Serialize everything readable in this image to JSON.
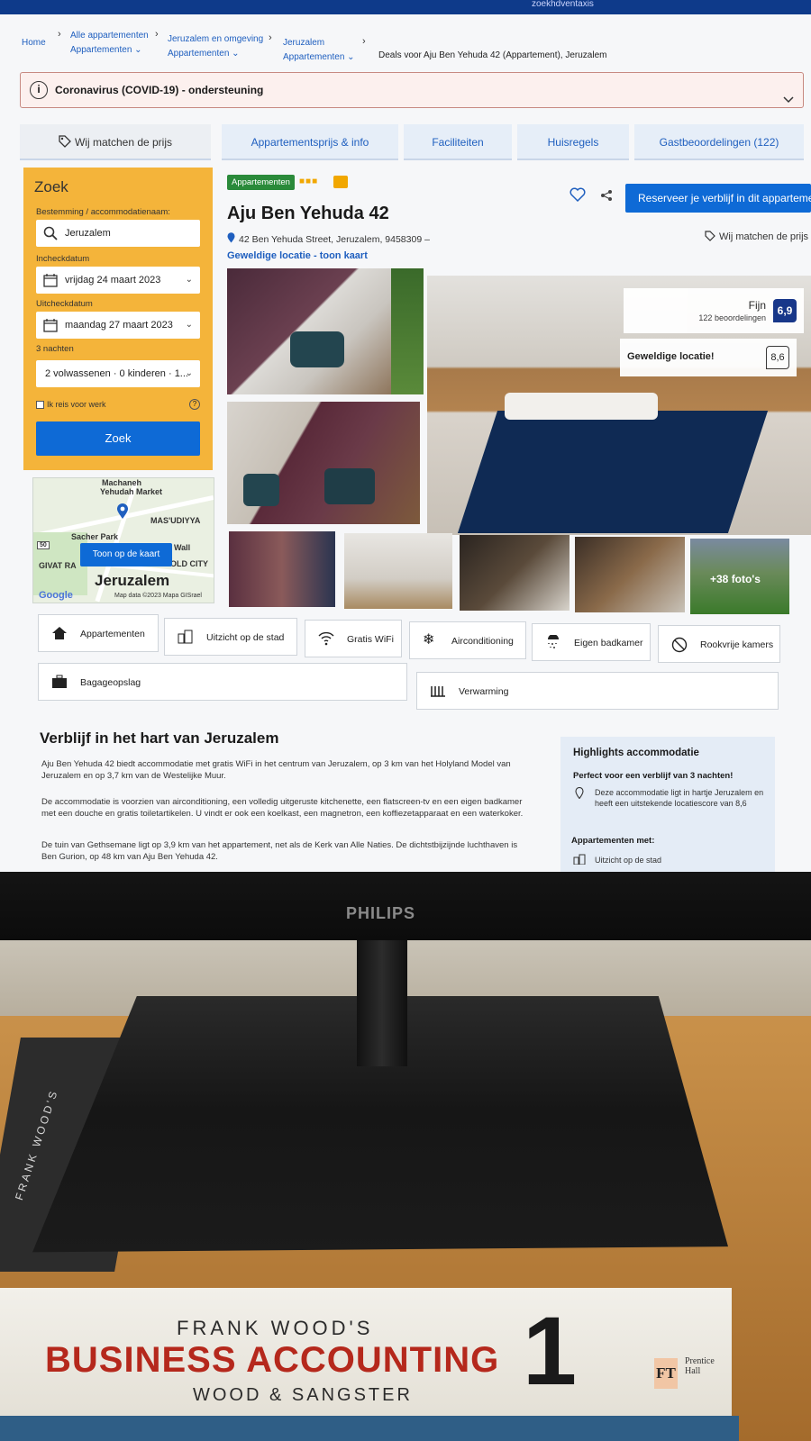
{
  "topbar": {
    "text": "zoekhdventaxis"
  },
  "breadcrumb": {
    "home": "Home",
    "c1": "Alle appartementen",
    "c1_sub": "Appartementen",
    "c2": "Jeruzalem en omgeving",
    "c2_sub": "Appartementen",
    "c3": "Jeruzalem",
    "c3_sub": "Appartementen",
    "c4": "Deals voor Aju Ben Yehuda 42 (Appartement), Jeruzalem"
  },
  "covid": {
    "text": "Coronavirus (COVID-19) - ondersteuning"
  },
  "tabs": [
    {
      "label": "Wij matchen de prijs"
    },
    {
      "label": "Appartementsprijs & info"
    },
    {
      "label": "Faciliteiten"
    },
    {
      "label": "Huisregels"
    },
    {
      "label": "Gastbeoordelingen (122)"
    }
  ],
  "search": {
    "title": "Zoek",
    "dest_label": "Bestemming / accommodatienaam:",
    "dest_value": "Jeruzalem",
    "checkin_label": "Incheckdatum",
    "checkin_value": "vrijdag 24 maart 2023",
    "checkout_label": "Uitcheckdatum",
    "checkout_value": "maandag 27 maart 2023",
    "nights": "3 nachten",
    "guests_value": "2 volwassenen · 0 kinderen · 1...",
    "work_label": "Ik reis voor werk",
    "button": "Zoek"
  },
  "map": {
    "city": "Jeruzalem",
    "button": "Toon op de kaart",
    "labels": [
      "Machaneh",
      "Yehudah Market",
      "MAS'UDIYYA",
      "Sacher Park",
      "GIVAT RA",
      "Wall",
      "OLD CITY",
      "50"
    ],
    "google": "Google",
    "copyright": "Map data ©2023 Mapa GISrael"
  },
  "property": {
    "type_badge": "Appartementen",
    "name": "Aju Ben Yehuda 42",
    "address": "42 Ben Yehuda Street, Jeruzalem, 9458309 –",
    "location_link": "Geweldige locatie - toon kaart",
    "reserve_button": "Reserveer je verblijf in dit appartement",
    "price_match": "Wij matchen de prijs",
    "rating_word": "Fijn",
    "rating_count": "122 beoordelingen",
    "rating_score": "6,9",
    "location_word": "Geweldige locatie!",
    "location_score": "8,6",
    "more_photos": "+38 foto's"
  },
  "facilities": [
    {
      "label": "Appartementen",
      "icon": "home-icon"
    },
    {
      "label": "Uitzicht op de stad",
      "icon": "city-icon"
    },
    {
      "label": "Gratis WiFi",
      "icon": "wifi-icon"
    },
    {
      "label": "Airconditioning",
      "icon": "snowflake-icon"
    },
    {
      "label": "Eigen badkamer",
      "icon": "shower-icon"
    },
    {
      "label": "Rookvrije kamers",
      "icon": "no-smoking-icon"
    },
    {
      "label": "Bagageopslag",
      "icon": "luggage-icon"
    },
    {
      "label": "Verwarming",
      "icon": "heater-icon"
    }
  ],
  "description": {
    "title": "Verblijf in het hart van Jeruzalem",
    "p1": "Aju Ben Yehuda 42 biedt accommodatie met gratis WiFi in het centrum van Jeruzalem, op 3 km van het Holyland Model van Jeruzalem en op 3,7 km van de Westelijke Muur.",
    "p2": "De accommodatie is voorzien van airconditioning, een volledig uitgeruste kitchenette, een flatscreen-tv en een eigen badkamer met een douche en gratis toiletartikelen. U vindt er ook een koelkast, een magnetron, een koffiezetapparaat en een waterkoker.",
    "p3": "De tuin van Gethsemane ligt op 3,9 km van het appartement, net als de Kerk van Alle Naties. De dichtstbijzijnde luchthaven is Ben Gurion, op 48 km van Aju Ben Yehuda 42."
  },
  "highlights": {
    "title": "Highlights accommodatie",
    "subtitle": "Perfect voor een verblijf van 3 nachten!",
    "desc": "Deze accommodatie ligt in hartje Jeruzalem en heeft een uitstekende locatiescore van 8,6",
    "apt_title": "Appartementen met:",
    "apt_item": "Uitzicht op de stad"
  },
  "scene": {
    "monitor_brand": "PHILIPS",
    "book_spine": "FRANK WOOD'S",
    "book_author": "FRANK WOOD'S",
    "book_title": "BUSINESS ACCOUNTING",
    "book_number": "1",
    "book_subtitle": "WOOD & SANGSTER",
    "book_logo": "FT",
    "book_publisher": "Prentice Hall"
  },
  "colors": {
    "brand_blue": "#0e6ad6",
    "search_yellow": "#f4b43a",
    "score_navy": "#0e2f86",
    "badge_green": "#2a8a3a"
  }
}
